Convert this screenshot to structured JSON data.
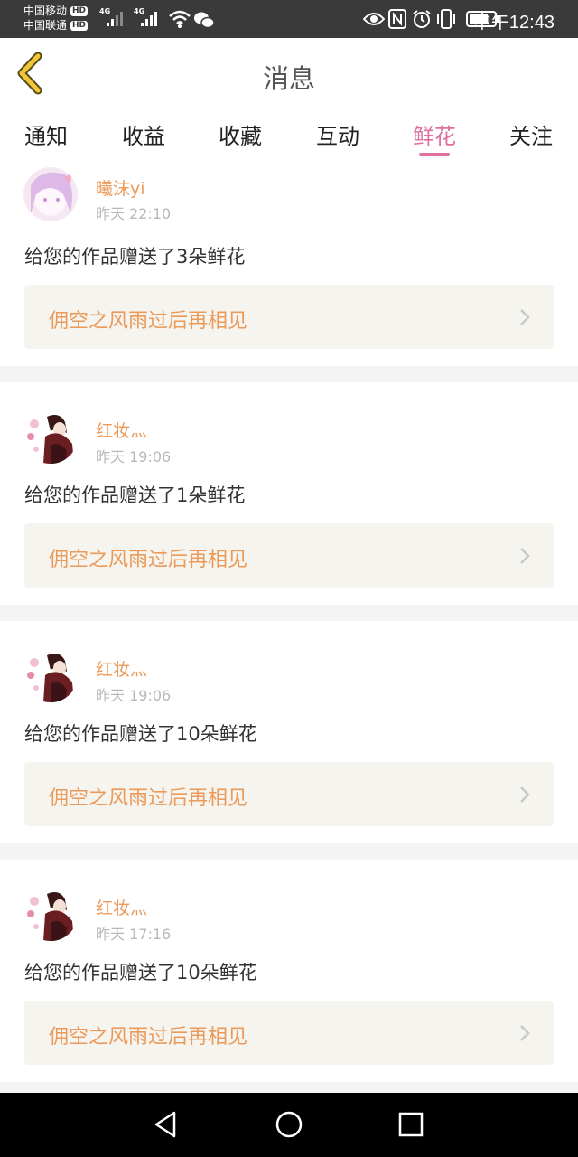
{
  "status_bar": {
    "carrier1": "中国移动",
    "carrier2": "中国联通",
    "hd_badge": "HD",
    "network1": "4G",
    "network2": "4G",
    "time": "中午12:43"
  },
  "header": {
    "title": "消息"
  },
  "tabs": [
    {
      "label": "通知"
    },
    {
      "label": "收益"
    },
    {
      "label": "收藏"
    },
    {
      "label": "互动"
    },
    {
      "label": "鲜花",
      "active": true
    },
    {
      "label": "关注"
    }
  ],
  "messages": [
    {
      "username": "曦沫yi",
      "time": "昨天 22:10",
      "text": "给您的作品赠送了3朵鲜花",
      "work_title": "佣空之风雨过后再相见"
    },
    {
      "username": "红妆灬",
      "time": "昨天 19:06",
      "text": "给您的作品赠送了1朵鲜花",
      "work_title": "佣空之风雨过后再相见"
    },
    {
      "username": "红妆灬",
      "time": "昨天 19:06",
      "text": "给您的作品赠送了10朵鲜花",
      "work_title": "佣空之风雨过后再相见"
    },
    {
      "username": "红妆灬",
      "time": "昨天 17:16",
      "text": "给您的作品赠送了10朵鲜花",
      "work_title": "佣空之风雨过后再相见"
    }
  ],
  "colors": {
    "accent": "#e0709e",
    "username": "#eb9a5a",
    "work_box_bg": "#f5f4ee"
  }
}
